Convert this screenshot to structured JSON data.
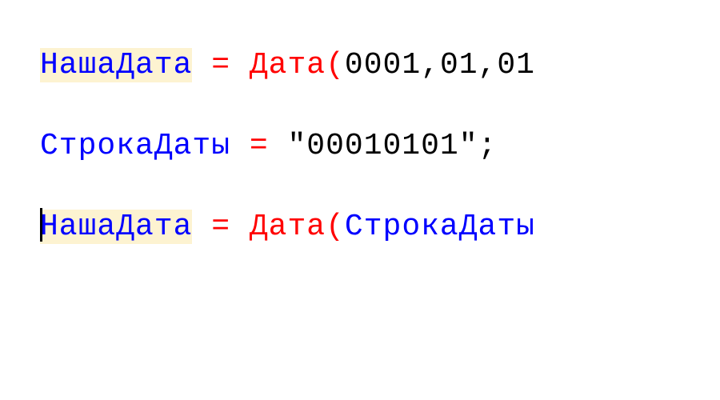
{
  "line1": {
    "var": "НашаДата",
    "eq": "=",
    "func": "Дата",
    "lparen": "(",
    "arg1": "0001",
    "comma1": ",",
    "arg2": "01",
    "comma2": ",",
    "arg3": "01"
  },
  "line2": {
    "var": "СтрокаДаты",
    "eq": "=",
    "str": "\"00010101\"",
    "semi": ";"
  },
  "line3": {
    "var": "НашаДата",
    "eq": "=",
    "func": "Дата",
    "lparen": "(",
    "arg": "СтрокаДаты"
  }
}
